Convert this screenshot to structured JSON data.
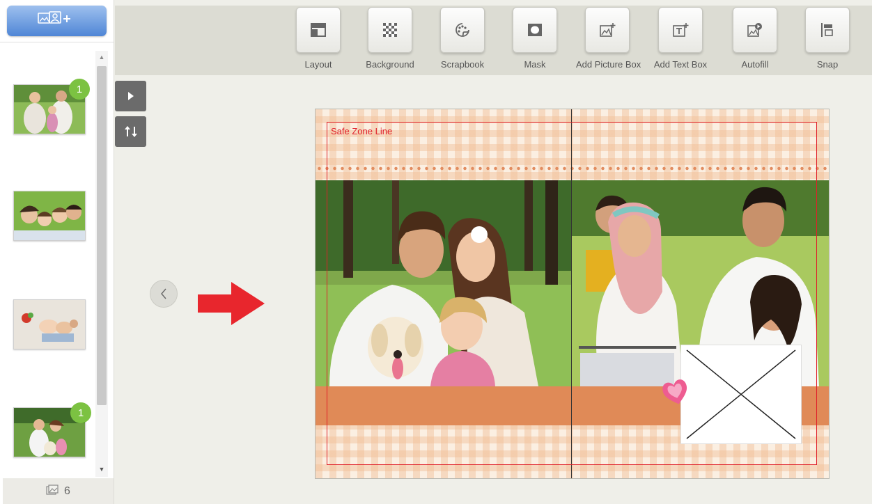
{
  "sidebar": {
    "add_photos_icon": "add-photos-icon",
    "thumbnails": [
      {
        "name": "grandparents-grandchild-bike-photo",
        "badge": "1"
      },
      {
        "name": "family-lying-on-grass-photo",
        "badge": ""
      },
      {
        "name": "family-on-white-bed-photo",
        "badge": ""
      },
      {
        "name": "family-in-park-photo",
        "badge": "1"
      }
    ],
    "photo_count": "6"
  },
  "toolbar": {
    "items": [
      {
        "label": "Layout",
        "icon": "layout-icon"
      },
      {
        "label": "Background",
        "icon": "background-icon"
      },
      {
        "label": "Scrapbook",
        "icon": "scrapbook-icon"
      },
      {
        "label": "Mask",
        "icon": "mask-icon"
      },
      {
        "label": "Add Picture Box",
        "icon": "add-picture-box-icon"
      },
      {
        "label": "Add Text Box",
        "icon": "add-text-box-icon"
      },
      {
        "label": "Autofill",
        "icon": "autofill-icon"
      },
      {
        "label": "Snap",
        "icon": "snap-icon"
      }
    ]
  },
  "canvas": {
    "safe_zone_label": "Safe Zone Line",
    "left_photo": "family-with-dog-photo",
    "right_photo": "family-on-bicycles-photo"
  },
  "colors": {
    "accent_blue": "#4f86d6",
    "badge_green": "#7cc242",
    "safe_zone_red": "#e0202a",
    "band_orange": "#e08a57",
    "arrow_red": "#e8262d"
  }
}
